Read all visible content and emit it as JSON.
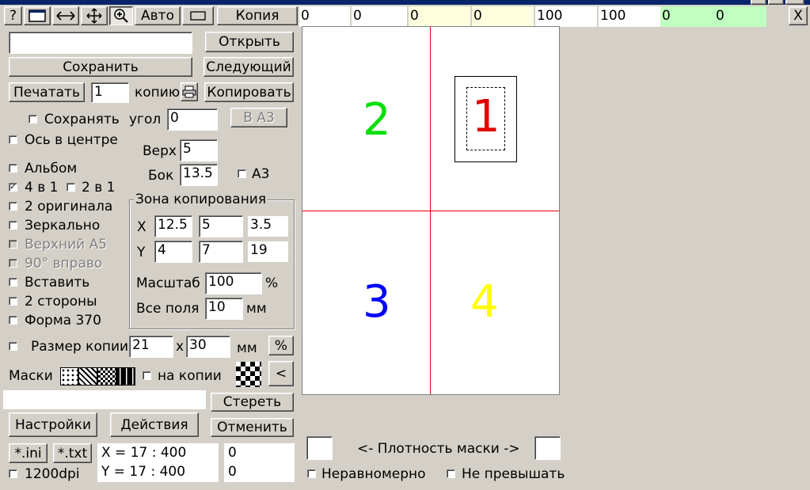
{
  "colors": {
    "page_yellow": "#ffffe0",
    "page_green": "#c0ffc0",
    "quadrant_2": "#00e000",
    "quadrant_1": "#e00000",
    "quadrant_3": "#0000ff",
    "quadrant_4": "#ffff00"
  },
  "toolbar": {
    "help": "?",
    "auto": "Авто",
    "copy": "Копия",
    "close": "X",
    "icons": [
      "page-icon",
      "horizontal-arrows-icon",
      "move-icon",
      "zoom-icon",
      "rectangle-icon"
    ]
  },
  "top_fields": [
    "0",
    "0",
    "0",
    "0",
    "100",
    "100",
    "0",
    "0"
  ],
  "left": {
    "filename_value": "",
    "open": "Открыть",
    "save": "Сохранить",
    "next": "Следующий",
    "print": "Печатать",
    "copies_value": "1",
    "copies_label": "копию",
    "copy_btn": "Копировать",
    "keep_label": "Сохранять",
    "angle_label": "угол",
    "angle_value": "0",
    "to_a3": "В А3",
    "axis_center": "Ось в центре",
    "top_label": "Верх",
    "top_value": "5",
    "side_label": "Бок",
    "side_value": "13.5",
    "a3_label": "А3",
    "album": "Альбом",
    "four_in_one": "4 в 1",
    "two_in_one": "2 в 1",
    "two_originals": "2 оригинала",
    "mirror": "Зеркально",
    "top_a5": "Верхний А5",
    "rotate_right": "90° вправо",
    "insert": "Вставить",
    "two_sides": "2 стороны",
    "form370": "Форма 370",
    "zone_title": "Зона копирования",
    "x_label": "X",
    "x_values": [
      "12.5",
      "5",
      "3.5"
    ],
    "y_label": "Y",
    "y_values": [
      "4",
      "7",
      "19"
    ],
    "scale_label": "Масштаб",
    "scale_value": "100",
    "percent": "%",
    "margins_label": "Все поля",
    "margins_value": "10",
    "mm": "мм",
    "copy_size_label": "Размер копии",
    "copy_w": "21",
    "times": "х",
    "copy_h": "30",
    "mm2": "мм",
    "pct_btn": "%",
    "masks_label": "Маски",
    "on_copies": "на копии",
    "lt_btn": "<",
    "erase_value": "",
    "erase": "Стереть",
    "settings": "Настройки",
    "actions": "Действия",
    "cancel": "Отменить",
    "ini": "*.ini",
    "txt": "*.txt",
    "dpi": "1200dpi",
    "x_coord": "X = 17 :  400",
    "y_coord": "Y = 17 :  400",
    "val1": "0",
    "val2": "0"
  },
  "preview": {
    "q1": "1",
    "q2": "2",
    "q3": "3",
    "q4": "4"
  },
  "bottom": {
    "density_label": "<- Плотность маски ->",
    "uneven": "Неравномерно",
    "not_exceed": "Не превышать"
  }
}
